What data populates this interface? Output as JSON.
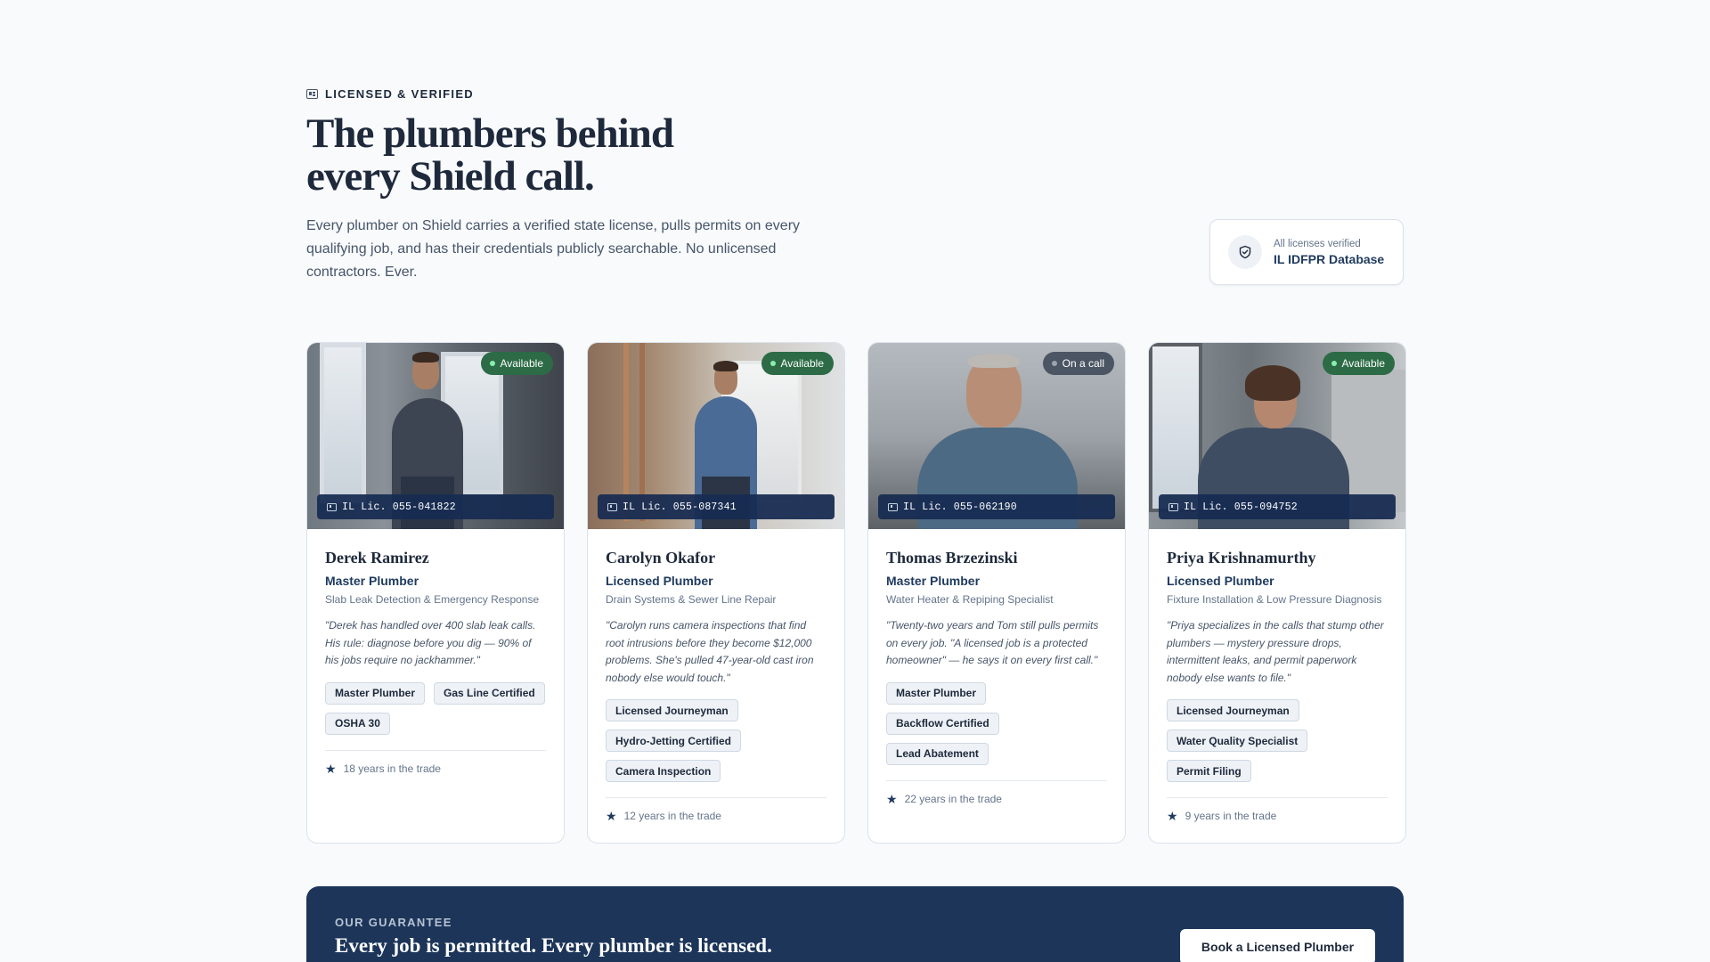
{
  "header": {
    "eyebrow": "LICENSED & VERIFIED",
    "title": "The plumbers behind every Shield call.",
    "lead": "Every plumber on Shield carries a verified state license, pulls permits on every qualifying job, and has their credentials publicly searchable. No unlicensed contractors. Ever."
  },
  "verification": {
    "label": "All licenses verified",
    "source": "IL IDFPR Database"
  },
  "plumbers": [
    {
      "name": "Derek Ramirez",
      "role": "Master Plumber",
      "specialty": "Slab Leak Detection & Emergency Response",
      "quote": "\"Derek has handled over 400 slab leak calls. His rule: diagnose before you dig — 90% of his jobs require no jackhammer.\"",
      "status": "Available",
      "license": "IL Lic. 055-041822",
      "tags": [
        "Master Plumber",
        "Gas Line Certified",
        "OSHA 30"
      ],
      "years": "18 years in the trade"
    },
    {
      "name": "Carolyn Okafor",
      "role": "Licensed Plumber",
      "specialty": "Drain Systems & Sewer Line Repair",
      "quote": "\"Carolyn runs camera inspections that find root intrusions before they become $12,000 problems. She's pulled 47-year-old cast iron nobody else would touch.\"",
      "status": "Available",
      "license": "IL Lic. 055-087341",
      "tags": [
        "Licensed Journeyman",
        "Hydro-Jetting Certified",
        "Camera Inspection"
      ],
      "years": "12 years in the trade"
    },
    {
      "name": "Thomas Brzezinski",
      "role": "Master Plumber",
      "specialty": "Water Heater & Repiping Specialist",
      "quote": "\"Twenty-two years and Tom still pulls permits on every job. \"A licensed job is a protected homeowner\" — he says it on every first call.\"",
      "status": "On a call",
      "license": "IL Lic. 055-062190",
      "tags": [
        "Master Plumber",
        "Backflow Certified",
        "Lead Abatement"
      ],
      "years": "22 years in the trade"
    },
    {
      "name": "Priya Krishnamurthy",
      "role": "Licensed Plumber",
      "specialty": "Fixture Installation & Low Pressure Diagnosis",
      "quote": "\"Priya specializes in the calls that stump other plumbers — mystery pressure drops, intermittent leaks, and permit paperwork nobody else wants to file.\"",
      "status": "Available",
      "license": "IL Lic. 055-094752",
      "tags": [
        "Licensed Journeyman",
        "Water Quality Specialist",
        "Permit Filing"
      ],
      "years": "9 years in the trade"
    }
  ],
  "guarantee": {
    "kicker": "OUR GUARANTEE",
    "headline": "Every job is permitted. Every plumber is licensed.",
    "cta": "Book a Licensed Plumber"
  },
  "colors": {
    "navy": "#1c3559",
    "available": "#2c6b46",
    "on_call": "#4b5563"
  }
}
